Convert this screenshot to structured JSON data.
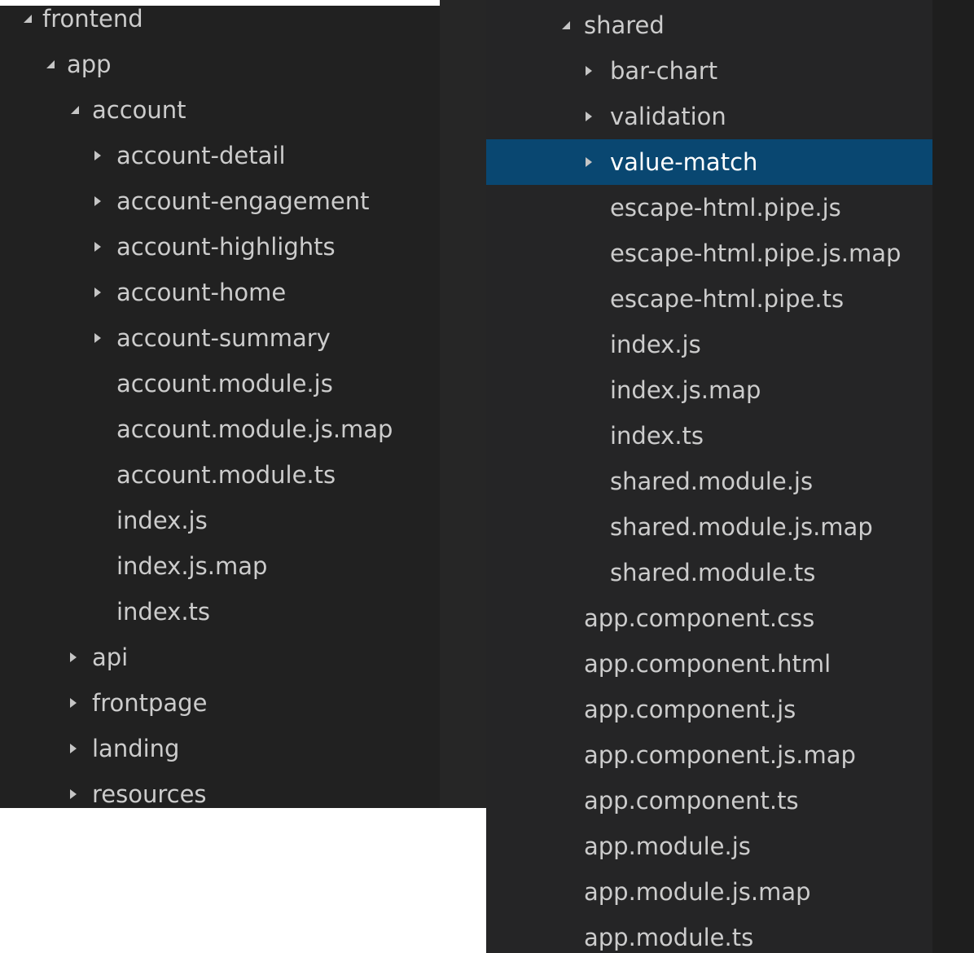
{
  "colors": {
    "tree_background": "#212121",
    "tree_text": "#cccccc",
    "selected_row": "#094771",
    "selected_text": "#ffffff",
    "twistie": "#c5c5c5"
  },
  "icons": {
    "expanded": "chevron-down-icon",
    "collapsed": "chevron-right-icon"
  },
  "left_tree": [
    {
      "label": "frontend",
      "type": "folder",
      "expanded": true
    },
    {
      "label": "app",
      "type": "folder",
      "expanded": true
    },
    {
      "label": "account",
      "type": "folder",
      "expanded": true
    },
    {
      "label": "account-detail",
      "type": "folder",
      "expanded": false
    },
    {
      "label": "account-engagement",
      "type": "folder",
      "expanded": false
    },
    {
      "label": "account-highlights",
      "type": "folder",
      "expanded": false
    },
    {
      "label": "account-home",
      "type": "folder",
      "expanded": false
    },
    {
      "label": "account-summary",
      "type": "folder",
      "expanded": false
    },
    {
      "label": "account.module.js",
      "type": "file"
    },
    {
      "label": "account.module.js.map",
      "type": "file"
    },
    {
      "label": "account.module.ts",
      "type": "file"
    },
    {
      "label": "index.js",
      "type": "file"
    },
    {
      "label": "index.js.map",
      "type": "file"
    },
    {
      "label": "index.ts",
      "type": "file"
    },
    {
      "label": "api",
      "type": "folder",
      "expanded": false
    },
    {
      "label": "frontpage",
      "type": "folder",
      "expanded": false
    },
    {
      "label": "landing",
      "type": "folder",
      "expanded": false
    },
    {
      "label": "resources",
      "type": "folder",
      "expanded": false
    }
  ],
  "right_tree": [
    {
      "label": "shared",
      "type": "folder",
      "expanded": true
    },
    {
      "label": "bar-chart",
      "type": "folder",
      "expanded": false
    },
    {
      "label": "validation",
      "type": "folder",
      "expanded": false
    },
    {
      "label": "value-match",
      "type": "folder",
      "expanded": false,
      "selected": true
    },
    {
      "label": "escape-html.pipe.js",
      "type": "file"
    },
    {
      "label": "escape-html.pipe.js.map",
      "type": "file"
    },
    {
      "label": "escape-html.pipe.ts",
      "type": "file"
    },
    {
      "label": "index.js",
      "type": "file"
    },
    {
      "label": "index.js.map",
      "type": "file"
    },
    {
      "label": "index.ts",
      "type": "file"
    },
    {
      "label": "shared.module.js",
      "type": "file"
    },
    {
      "label": "shared.module.js.map",
      "type": "file"
    },
    {
      "label": "shared.module.ts",
      "type": "file"
    },
    {
      "label": "app.component.css",
      "type": "file"
    },
    {
      "label": "app.component.html",
      "type": "file"
    },
    {
      "label": "app.component.js",
      "type": "file"
    },
    {
      "label": "app.component.js.map",
      "type": "file"
    },
    {
      "label": "app.component.ts",
      "type": "file"
    },
    {
      "label": "app.module.js",
      "type": "file"
    },
    {
      "label": "app.module.js.map",
      "type": "file"
    },
    {
      "label": "app.module.ts",
      "type": "file"
    }
  ]
}
